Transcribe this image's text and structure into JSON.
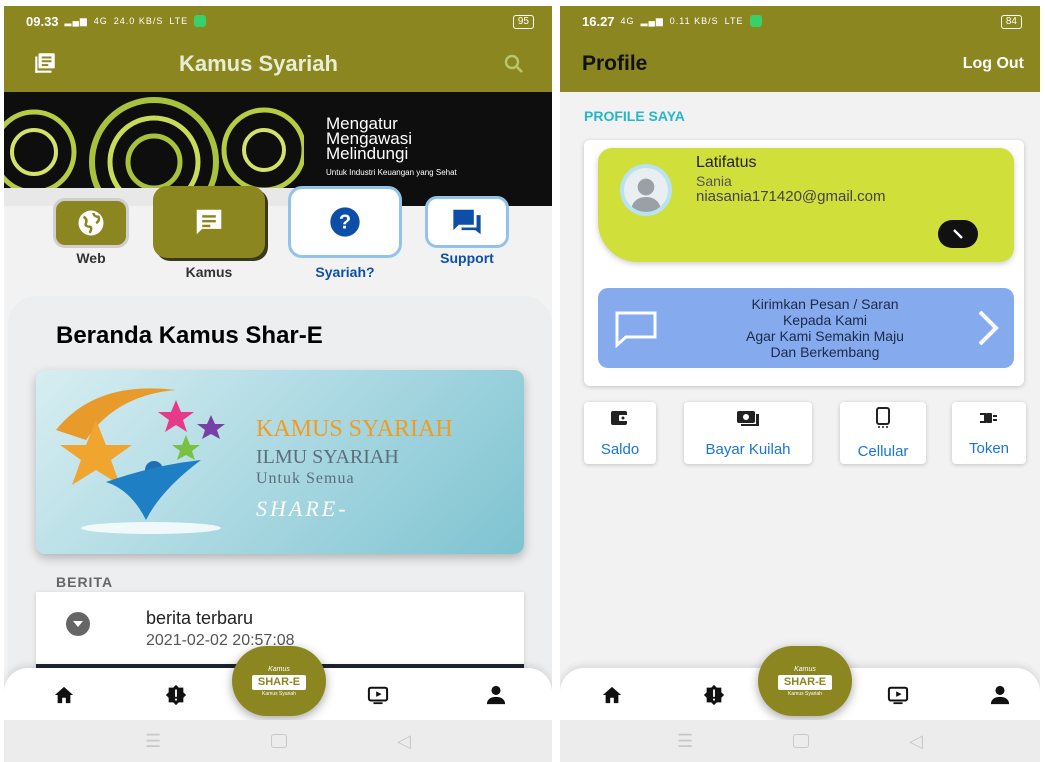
{
  "left": {
    "status": {
      "time": "09.33",
      "net1": "4G",
      "speed": "24.0 KB/S",
      "lte": "LTE",
      "battery": "95"
    },
    "app_title": "Kamus Syariah",
    "banner": {
      "line1": "Mengatur",
      "line2": "Mengawasi",
      "line3": "Melindungi",
      "line4": "Untuk Industri Keuangan yang Sehat"
    },
    "categories": [
      {
        "label": "Web",
        "icon": "globe-icon"
      },
      {
        "label": "Kamus",
        "icon": "chat-icon"
      },
      {
        "label": "Syariah?",
        "icon": "help-icon"
      },
      {
        "label": "Support",
        "icon": "forum-icon"
      }
    ],
    "section_title": "Beranda Kamus Shar-E",
    "promo": {
      "line1": "KAMUS SYARIAH",
      "line2": "ILMU SYARIAH",
      "line3": "Untuk Semua",
      "line4": "SHARE-"
    },
    "berita_label": "BERITA",
    "news": {
      "title": "berita terbaru",
      "datetime": "2021-02-02 20:57:08"
    },
    "fab": {
      "top": "Kamus",
      "main": "SHAR-E",
      "sub": "Kamus Syariah"
    }
  },
  "right": {
    "status": {
      "time": "16.27",
      "net1": "4G",
      "speed": "0.11 KB/S",
      "lte": "LTE",
      "battery": "84"
    },
    "header_title": "Profile",
    "logout": "Log Out",
    "section_label": "PROFILE SAYA",
    "user": {
      "first": "Latifatus",
      "last": "Sania",
      "email": "niasania171420@gmail.com"
    },
    "message": {
      "line1": "Kirimkan Pesan / Saran",
      "line2": "Kepada Kami",
      "line3": "Agar Kami Semakin Maju",
      "line4": "Dan Berkembang"
    },
    "actions": [
      {
        "label": "Saldo",
        "icon": "wallet-icon"
      },
      {
        "label": "Bayar Kuilah",
        "icon": "payment-icon"
      },
      {
        "label": "Cellular",
        "icon": "phone-icon"
      },
      {
        "label": "Token",
        "icon": "power-plug-icon"
      }
    ],
    "fab": {
      "top": "Kamus",
      "main": "SHAR-E",
      "sub": "Kamus Syariah"
    }
  },
  "colors": {
    "olive": "#8b8620",
    "lime_card": "#d1df3a",
    "blue_card": "#86aaee",
    "accent_blue": "#1976d2",
    "teal_label": "#26b6c9"
  }
}
